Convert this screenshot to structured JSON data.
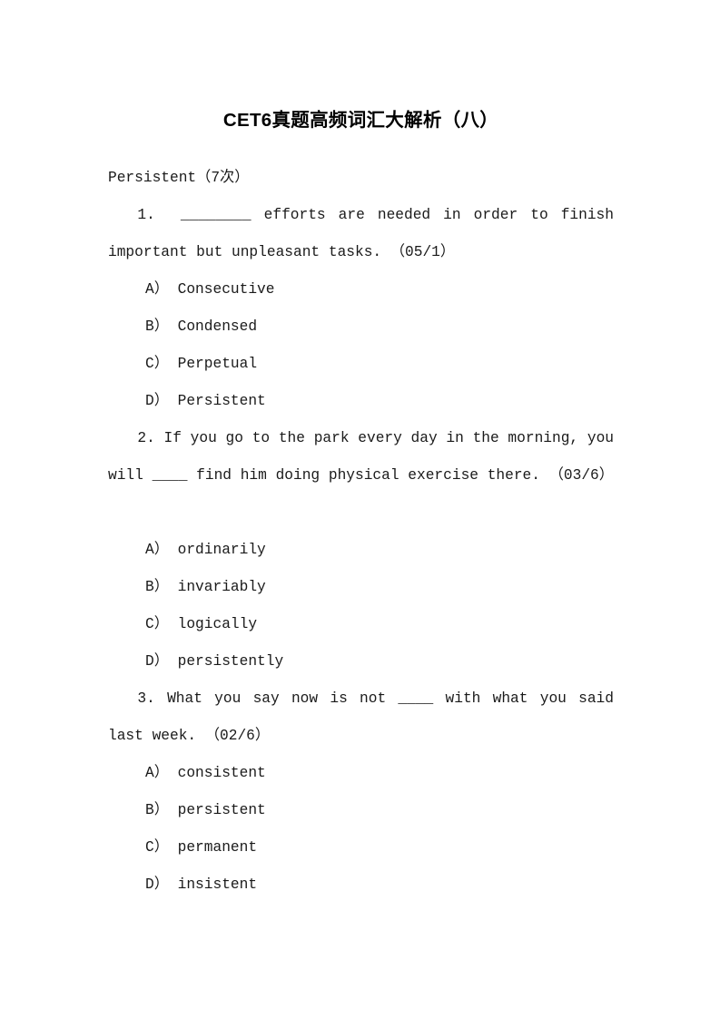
{
  "document": {
    "title": "CET6真题高频词汇大解析（八）",
    "headword": "Persistent（7次）",
    "background_color": "#ffffff",
    "text_color": "#1a1a1a"
  },
  "questions": [
    {
      "number": "1.",
      "stem": "1.  ________ efforts are needed in order to finish important but unpleasant tasks. （05/1）",
      "source": "（05/1）",
      "blank": "________",
      "extra_gap_after_stem": false,
      "options": [
        {
          "letter": "A）",
          "text": "Consecutive"
        },
        {
          "letter": "B）",
          "text": "Condensed"
        },
        {
          "letter": "C）",
          "text": "Perpetual"
        },
        {
          "letter": "D）",
          "text": "Persistent"
        }
      ]
    },
    {
      "number": "2.",
      "stem": "2. If you go to the park every day in the morning, you will ____ find him doing physical exercise there. （03/6）",
      "source": "（03/6）",
      "blank": "____",
      "extra_gap_after_stem": true,
      "options": [
        {
          "letter": "A）",
          "text": "ordinarily"
        },
        {
          "letter": "B）",
          "text": "invariably"
        },
        {
          "letter": "C）",
          "text": "logically"
        },
        {
          "letter": "D）",
          "text": "persistently"
        }
      ]
    },
    {
      "number": "3.",
      "stem": "3. What you say now is not ____ with what you said last week. （02/6）",
      "source": "（02/6）",
      "blank": "____",
      "extra_gap_after_stem": false,
      "options": [
        {
          "letter": "A）",
          "text": "consistent"
        },
        {
          "letter": "B）",
          "text": "persistent"
        },
        {
          "letter": "C）",
          "text": "permanent"
        },
        {
          "letter": "D）",
          "text": "insistent"
        }
      ]
    }
  ]
}
